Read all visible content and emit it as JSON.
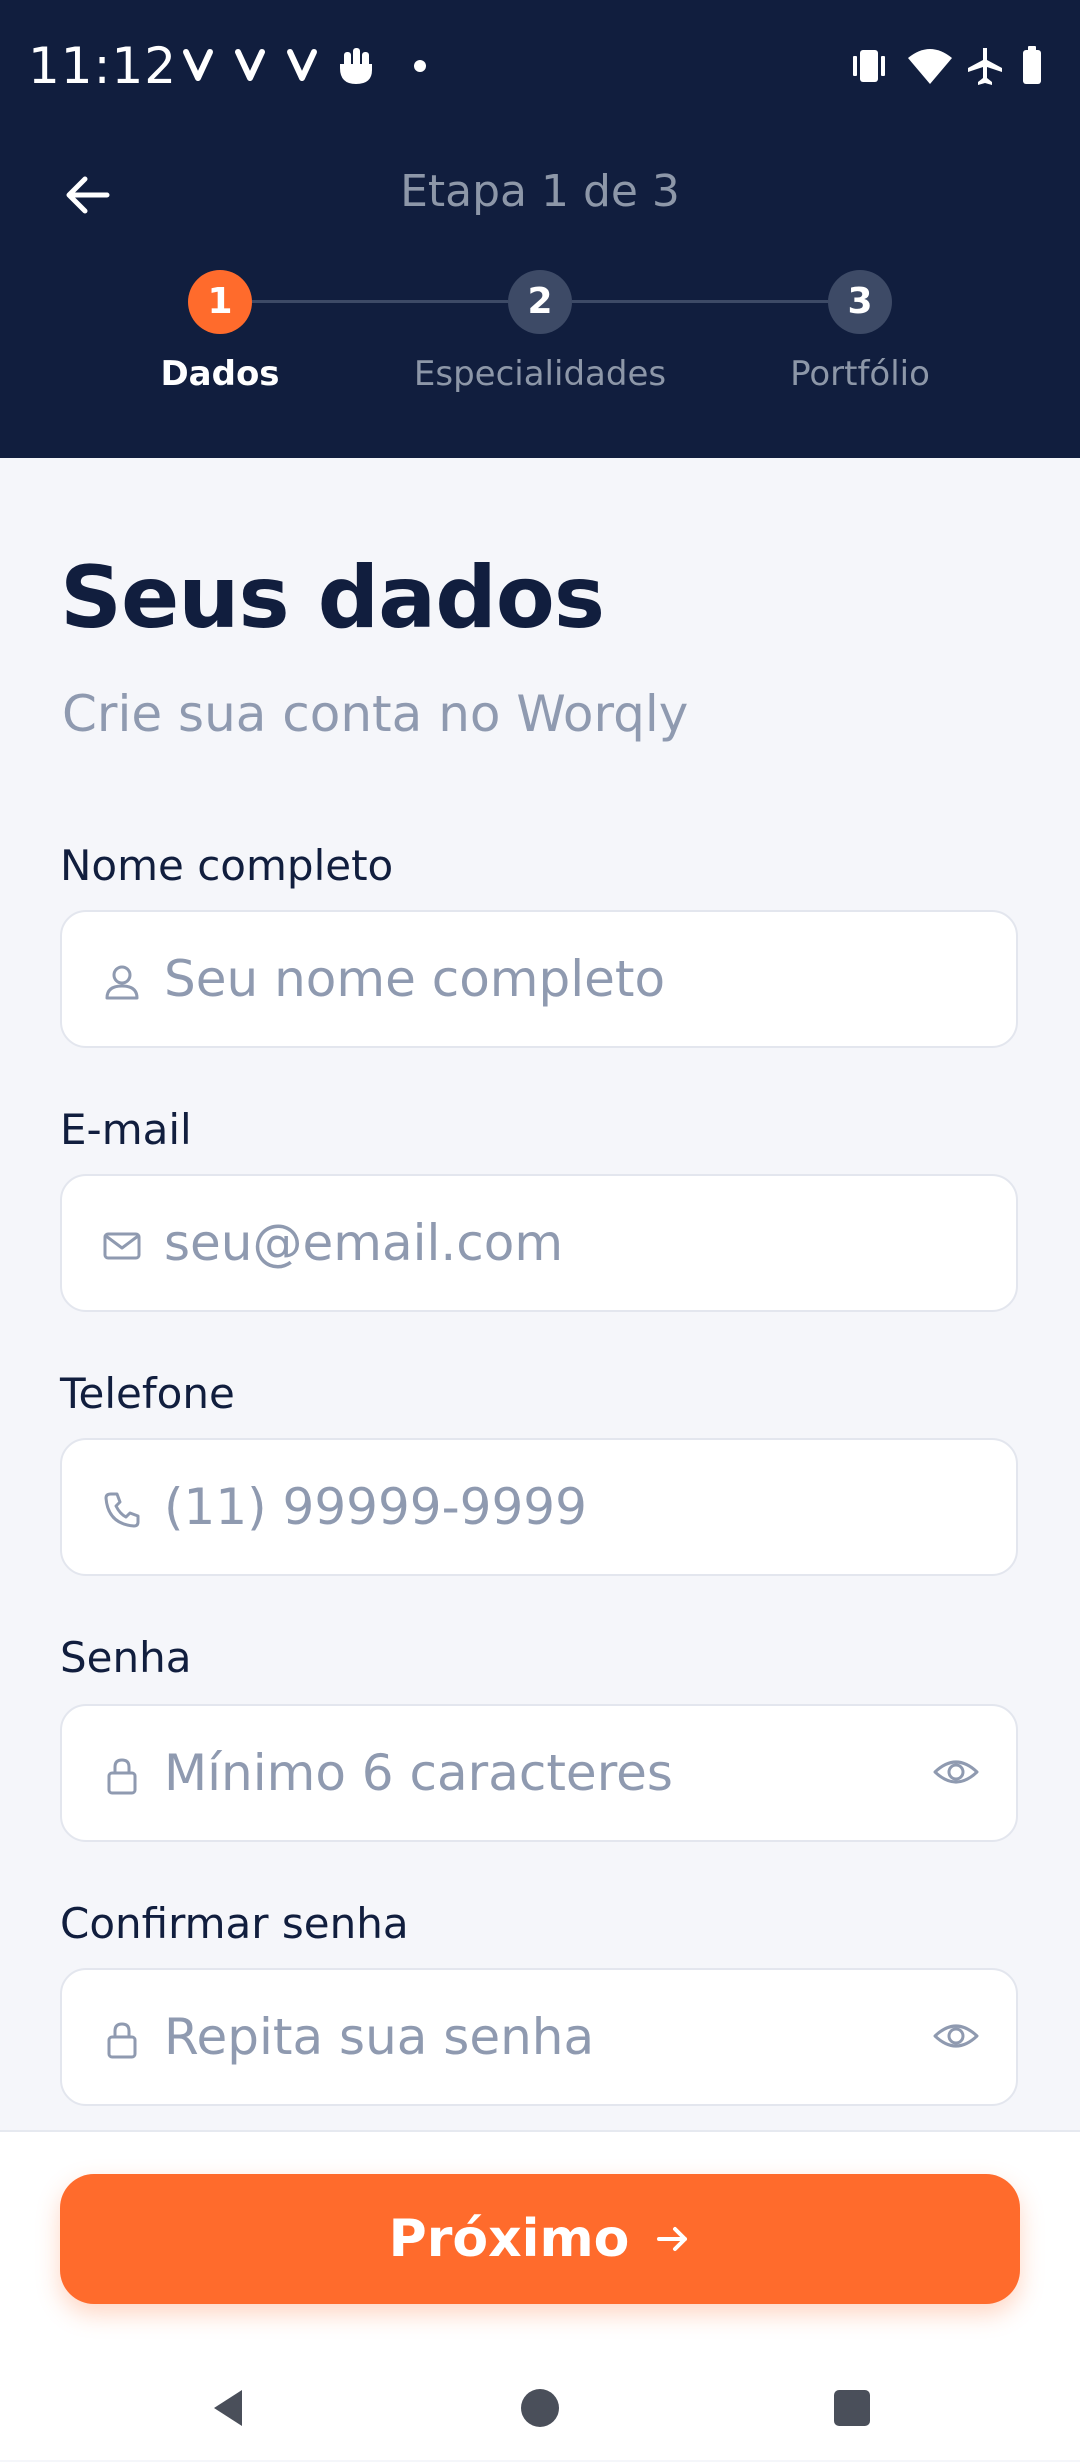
{
  "status_bar": {
    "time": "11:12",
    "notification_icons": [
      "v-app-icon",
      "v-app-icon",
      "v-app-icon",
      "hand-icon",
      "dot-icon"
    ],
    "system_icons": [
      "vibrate-icon",
      "wifi-icon",
      "airplane-icon",
      "battery-icon"
    ]
  },
  "header": {
    "step_title": "Etapa 1 de 3",
    "steps": [
      {
        "number": "1",
        "label": "Dados",
        "active": true
      },
      {
        "number": "2",
        "label": "Especialidades",
        "active": false
      },
      {
        "number": "3",
        "label": "Portfólio",
        "active": false
      }
    ]
  },
  "form": {
    "title": "Seus dados",
    "subtitle": "Crie sua conta no Worqly",
    "fields": [
      {
        "label": "Nome completo",
        "placeholder": "Seu nome completo",
        "value": "",
        "icon": "user-icon"
      },
      {
        "label": "E-mail",
        "placeholder": "seu@email.com",
        "value": "",
        "icon": "mail-icon"
      },
      {
        "label": "Telefone",
        "placeholder": "(11) 99999-9999",
        "value": "",
        "icon": "phone-icon"
      },
      {
        "label": "Senha",
        "placeholder": "Mínimo 6 caracteres",
        "value": "",
        "icon": "lock-icon",
        "toggle_icon": "eye-icon"
      },
      {
        "label": "Confirmar senha",
        "placeholder": "Repita sua senha",
        "value": "",
        "icon": "lock-icon",
        "toggle_icon": "eye-icon"
      }
    ]
  },
  "footer": {
    "next_label": "Próximo",
    "next_icon": "arrow-right-icon"
  },
  "colors": {
    "header_bg": "#111E3E",
    "accent": "#FF6B2C",
    "text_dark": "#111E3E",
    "text_muted": "#8F9AB0",
    "page_bg": "#F5F6FA"
  }
}
